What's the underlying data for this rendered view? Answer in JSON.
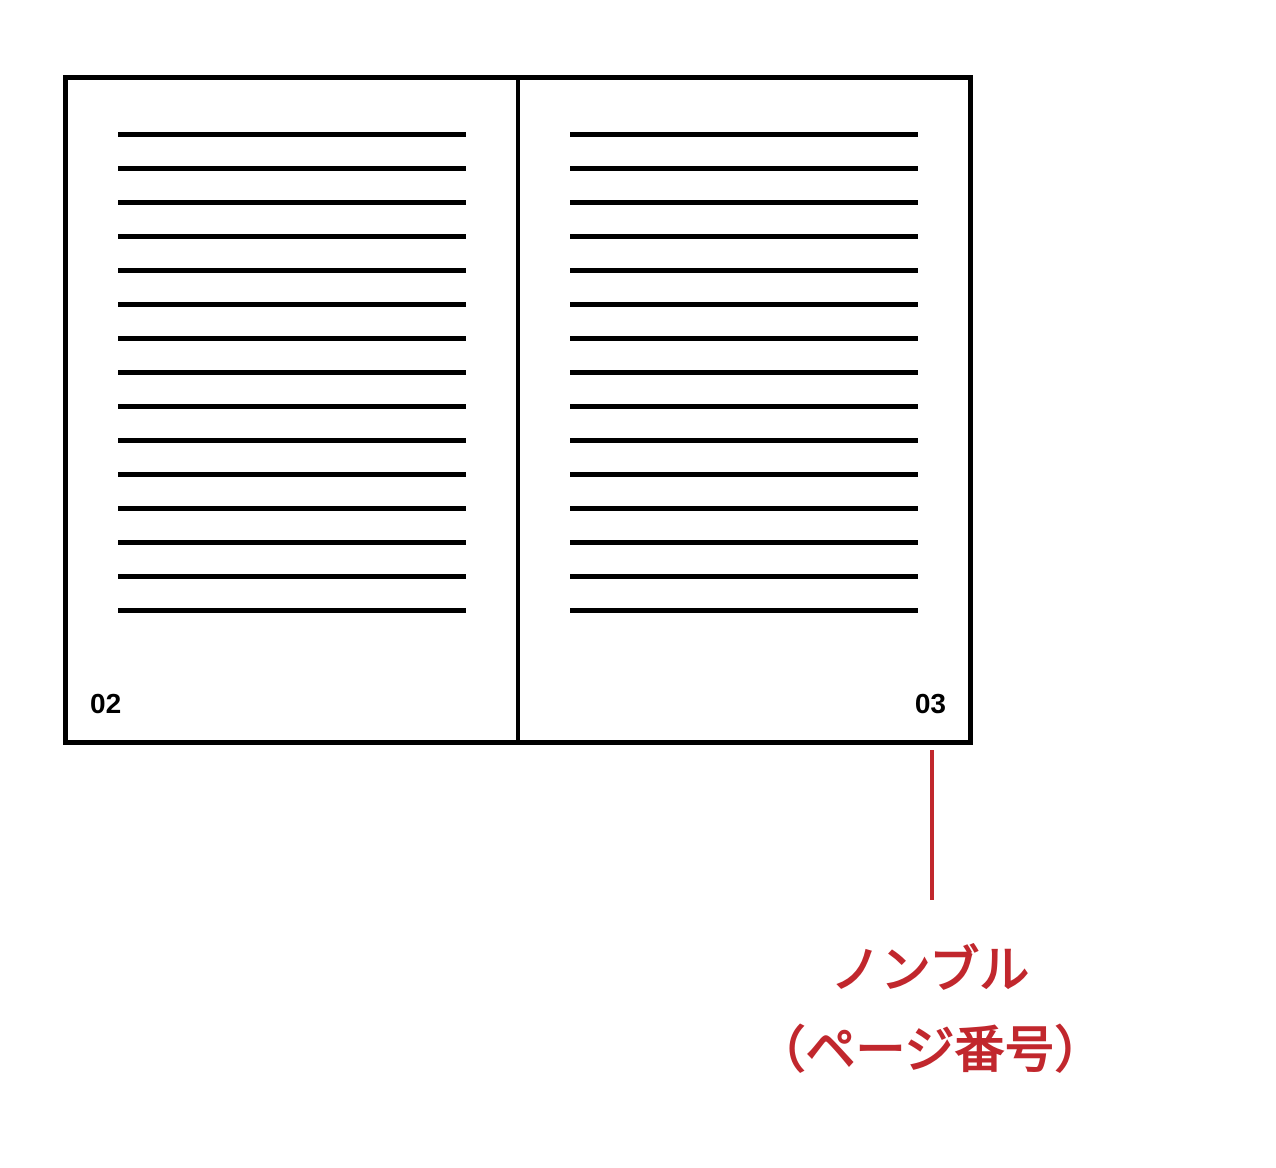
{
  "book": {
    "left_page": {
      "number": "02",
      "line_count": 15
    },
    "right_page": {
      "number": "03",
      "line_count": 15
    }
  },
  "annotation": {
    "title": "ノンブル",
    "subtitle": "（ページ番号）",
    "color": "#c1272d"
  }
}
